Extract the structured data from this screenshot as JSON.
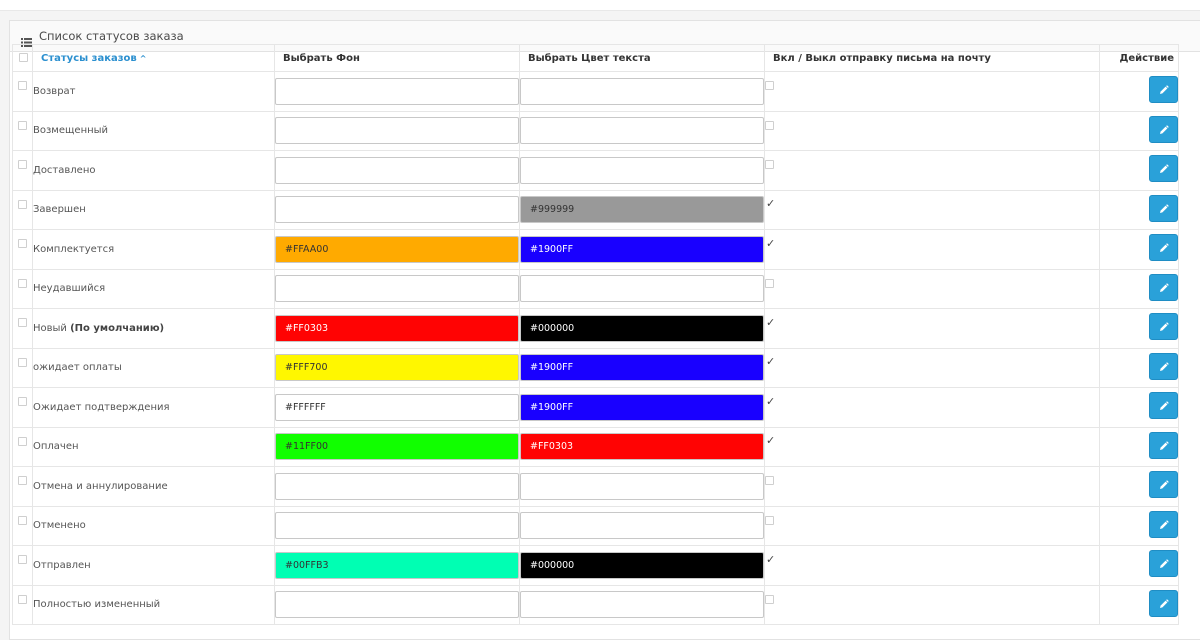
{
  "panel": {
    "title": "Список статусов заказа"
  },
  "table": {
    "headers": {
      "status": "Статусы заказов",
      "background": "Выбрать Фон",
      "text_color": "Выбрать Цвет текста",
      "mail": "Вкл / Выкл отправку письма на почту",
      "action": "Действие"
    },
    "rows": [
      {
        "name": "Возврат",
        "default_label": "",
        "bg": "",
        "bg_hex": "",
        "bg_text": "#333333",
        "fg": "",
        "fg_hex": "",
        "fg_text": "#333333",
        "mail": false
      },
      {
        "name": "Возмещенный",
        "default_label": "",
        "bg": "",
        "bg_hex": "",
        "bg_text": "#333333",
        "fg": "",
        "fg_hex": "",
        "fg_text": "#333333",
        "mail": false
      },
      {
        "name": "Доставлено",
        "default_label": "",
        "bg": "",
        "bg_hex": "",
        "bg_text": "#333333",
        "fg": "",
        "fg_hex": "",
        "fg_text": "#333333",
        "mail": false
      },
      {
        "name": "Завершен",
        "default_label": "",
        "bg": "",
        "bg_hex": "",
        "bg_text": "#333333",
        "fg": "#999999",
        "fg_hex": "#999999",
        "fg_text": "#333333",
        "mail": true
      },
      {
        "name": "Комплектуется",
        "default_label": "",
        "bg": "#FFAA00",
        "bg_hex": "#FFAA00",
        "bg_text": "#333333",
        "fg": "#1900FF",
        "fg_hex": "#1900FF",
        "fg_text": "#ffffff",
        "mail": true
      },
      {
        "name": "Неудавшийся",
        "default_label": "",
        "bg": "",
        "bg_hex": "",
        "bg_text": "#333333",
        "fg": "",
        "fg_hex": "",
        "fg_text": "#333333",
        "mail": false
      },
      {
        "name": "Новый ",
        "default_label": "(По умолчанию)",
        "bg": "#FF0303",
        "bg_hex": "#FF0303",
        "bg_text": "#ffffff",
        "fg": "#000000",
        "fg_hex": "#000000",
        "fg_text": "#ffffff",
        "mail": true
      },
      {
        "name": "ожидает оплаты",
        "default_label": "",
        "bg": "#FFF700",
        "bg_hex": "#FFF700",
        "bg_text": "#333333",
        "fg": "#1900FF",
        "fg_hex": "#1900FF",
        "fg_text": "#ffffff",
        "mail": true
      },
      {
        "name": "Ожидает подтверждения",
        "default_label": "",
        "bg": "#FFFFFF",
        "bg_hex": "#FFFFFF",
        "bg_text": "#333333",
        "fg": "#1900FF",
        "fg_hex": "#1900FF",
        "fg_text": "#ffffff",
        "mail": true
      },
      {
        "name": "Оплачен",
        "default_label": "",
        "bg": "#11FF00",
        "bg_hex": "#11FF00",
        "bg_text": "#333333",
        "fg": "#FF0303",
        "fg_hex": "#FF0303",
        "fg_text": "#ffffff",
        "mail": true
      },
      {
        "name": "Отмена и аннулирование",
        "default_label": "",
        "bg": "",
        "bg_hex": "",
        "bg_text": "#333333",
        "fg": "",
        "fg_hex": "",
        "fg_text": "#333333",
        "mail": false
      },
      {
        "name": "Отменено",
        "default_label": "",
        "bg": "",
        "bg_hex": "",
        "bg_text": "#333333",
        "fg": "",
        "fg_hex": "",
        "fg_text": "#333333",
        "mail": false
      },
      {
        "name": "Отправлен",
        "default_label": "",
        "bg": "#00FFB3",
        "bg_hex": "#00FFB3",
        "bg_text": "#333333",
        "fg": "#000000",
        "fg_hex": "#000000",
        "fg_text": "#ffffff",
        "mail": true
      },
      {
        "name": "Полностью измененный",
        "default_label": "",
        "bg": "",
        "bg_hex": "",
        "bg_text": "#333333",
        "fg": "",
        "fg_hex": "",
        "fg_text": "#333333",
        "mail": false
      }
    ]
  },
  "colors": {
    "accent": "#2a8fcf",
    "button": "#2aa1d9"
  },
  "icons": {
    "panel": "list-icon",
    "sort": "caret-up-icon",
    "edit": "pencil-icon",
    "mail_on": "check-icon"
  }
}
